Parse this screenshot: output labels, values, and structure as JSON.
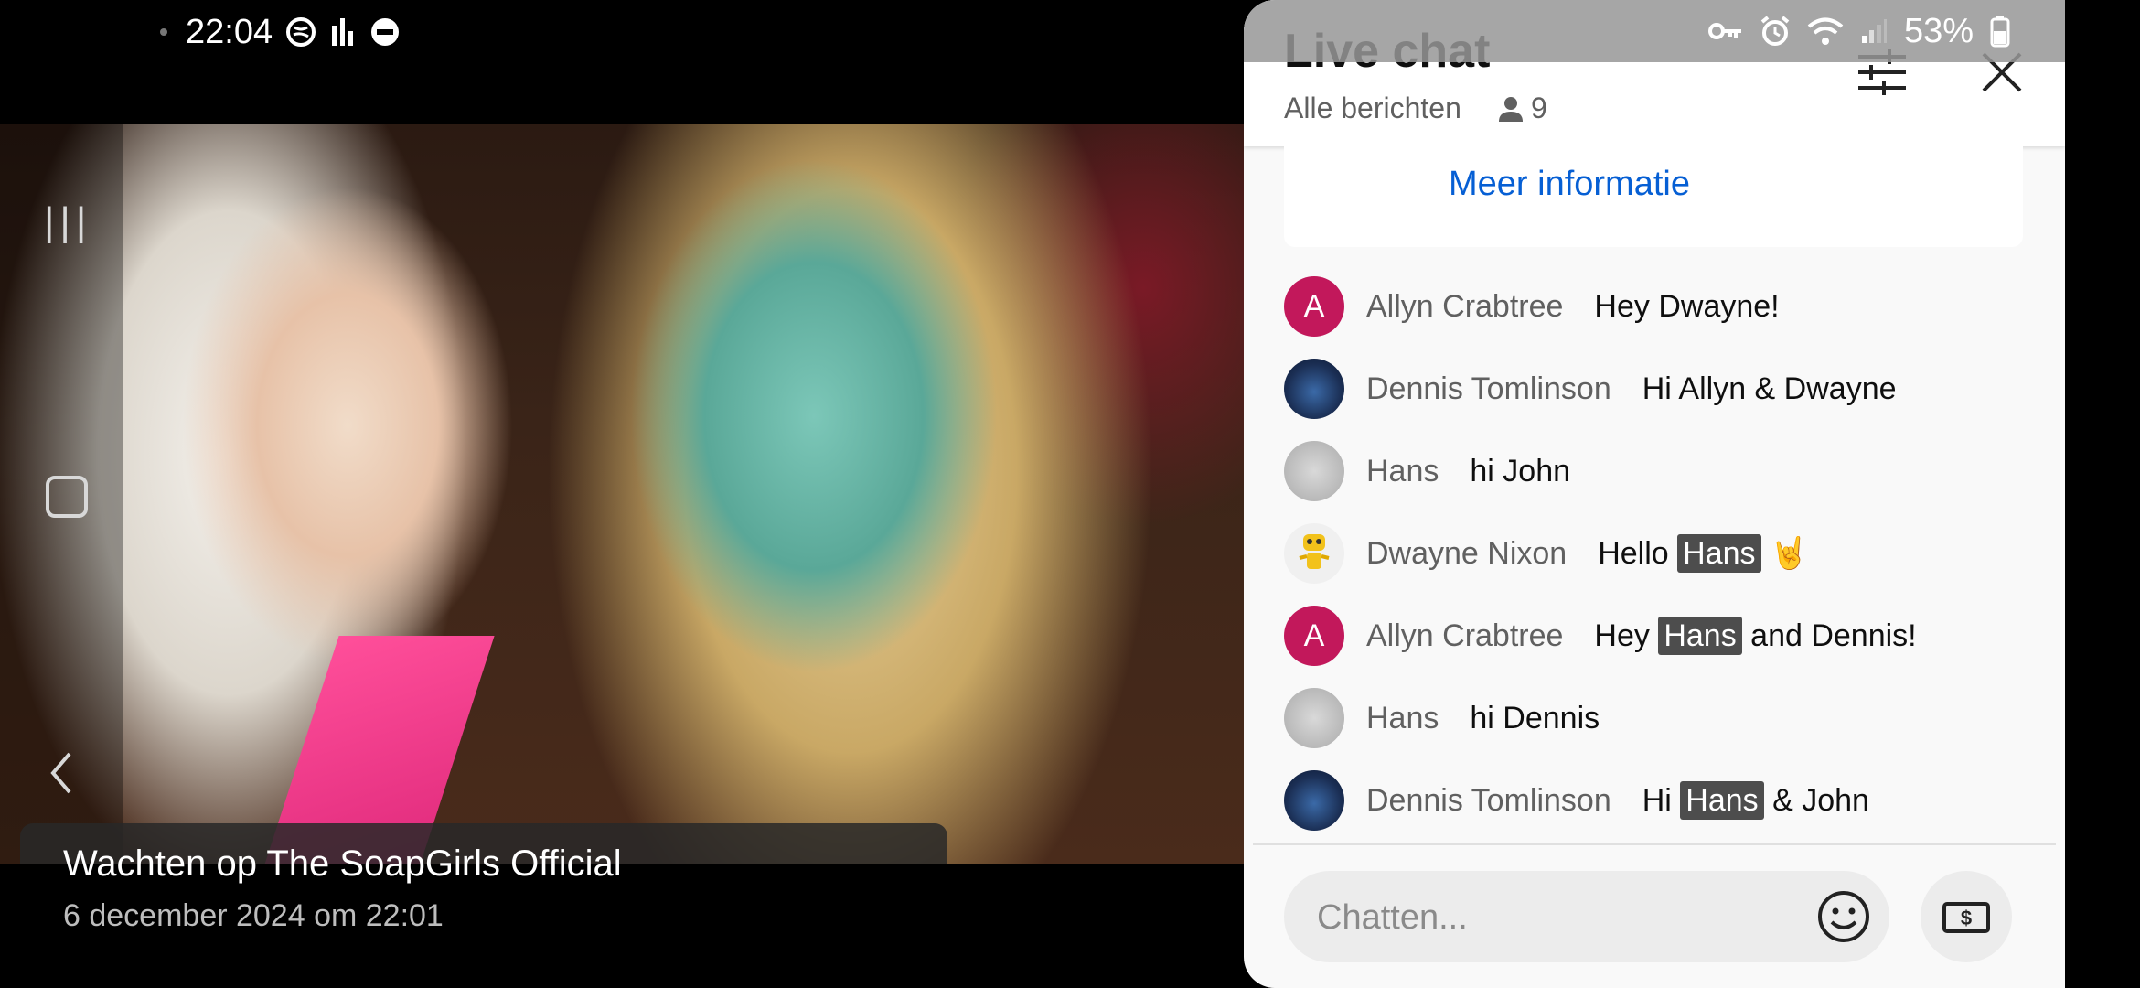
{
  "status_bar": {
    "time": "22:04",
    "battery": "53%"
  },
  "video": {
    "title": "Wachten op The SoapGirls Official",
    "date": "6 december 2024 om 22:01"
  },
  "chat": {
    "title": "Live chat",
    "filter_label": "Alle berichten",
    "viewer_count": "9",
    "more_info": "Meer informatie",
    "input_placeholder": "Chatten...",
    "messages": [
      {
        "author": "Allyn Crabtree",
        "avatar": "A",
        "pre": "Hey Dwayne!",
        "mention": "",
        "post": ""
      },
      {
        "author": "Dennis Tomlinson",
        "avatar": "",
        "pre": "Hi Allyn & Dwayne",
        "mention": "",
        "post": ""
      },
      {
        "author": "Hans",
        "avatar": "",
        "pre": "hi John",
        "mention": "",
        "post": ""
      },
      {
        "author": "Dwayne Nixon",
        "avatar": "",
        "pre": "Hello ",
        "mention": "Hans",
        "post": " 🤘"
      },
      {
        "author": "Allyn Crabtree",
        "avatar": "A",
        "pre": "Hey ",
        "mention": "Hans",
        "post": " and Dennis!"
      },
      {
        "author": "Hans",
        "avatar": "",
        "pre": "hi Dennis",
        "mention": "",
        "post": ""
      },
      {
        "author": "Dennis Tomlinson",
        "avatar": "",
        "pre": "Hi ",
        "mention": "Hans",
        "post": " & John"
      }
    ]
  }
}
